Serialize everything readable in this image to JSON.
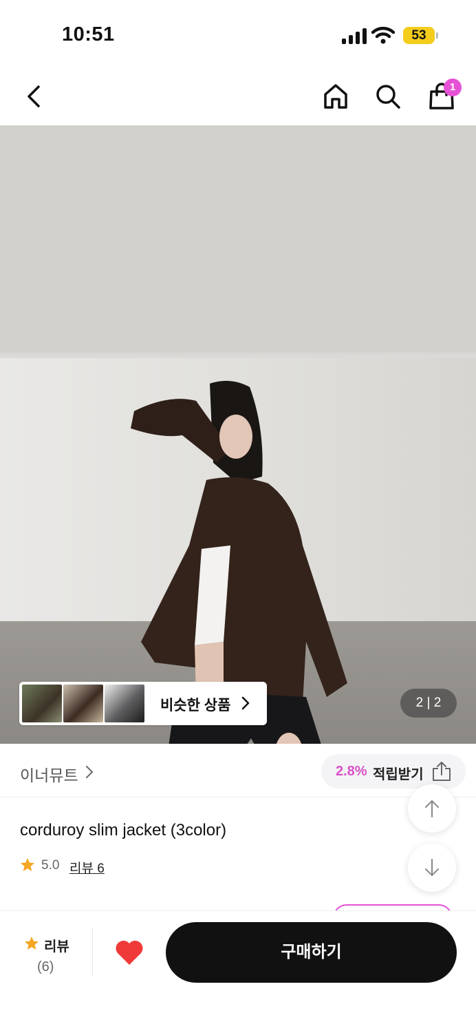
{
  "status_bar": {
    "time": "10:51",
    "battery": "53",
    "battery_color": "#f4cc1b"
  },
  "header": {
    "cart_badge": "1",
    "accent_color": "#e652d6"
  },
  "gallery": {
    "similar_label": "비슷한 상품",
    "page_indicator": "2 | 2"
  },
  "brand": {
    "name": "이너뮤트",
    "reward_percent": "2.8%",
    "reward_label": "적립받기"
  },
  "product": {
    "title": "corduroy slim jacket (3color)",
    "rating": "5.0",
    "review_link": "리뷰 6"
  },
  "bottom_bar": {
    "review_label": "리뷰",
    "review_count": "(6)",
    "buy_label": "구매하기",
    "heart_color": "#f03a3a"
  }
}
